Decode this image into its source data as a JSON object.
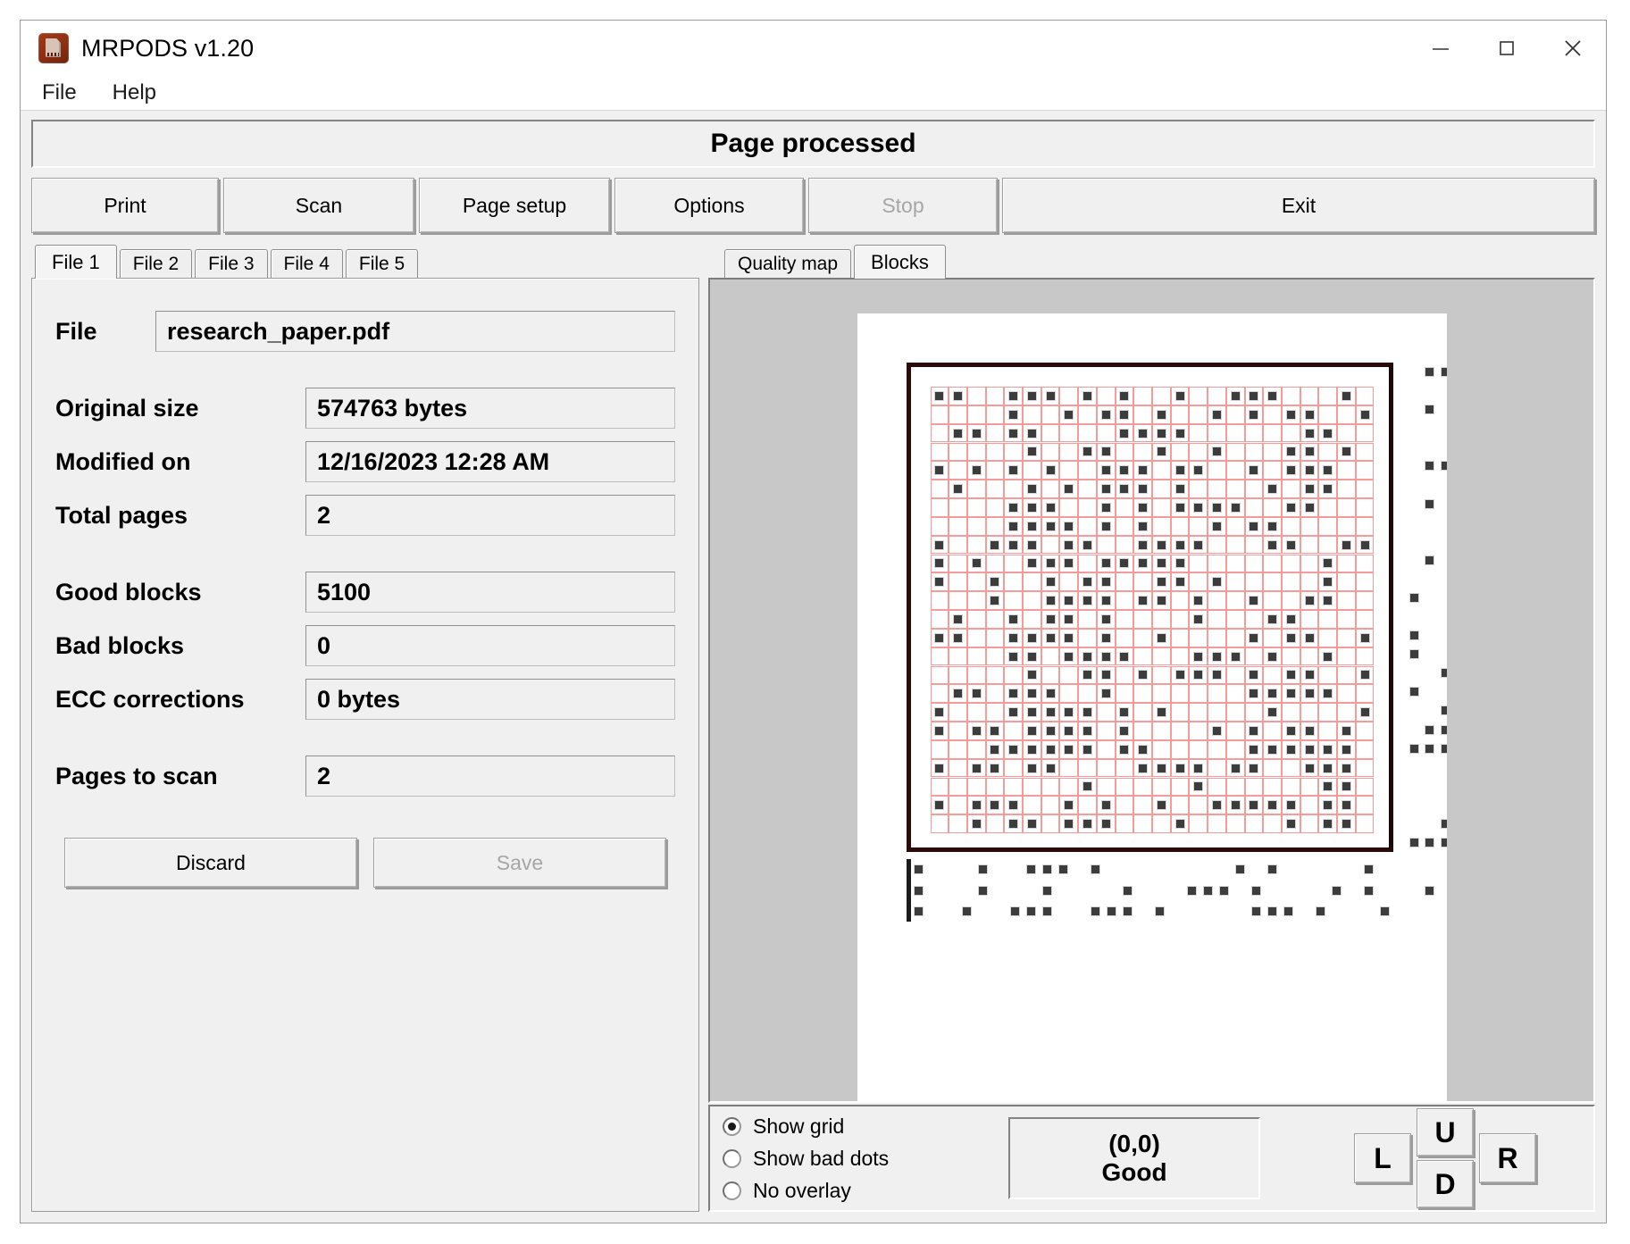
{
  "window": {
    "title": "MRPODS v1.20",
    "icon": "app-document-icon",
    "controls": {
      "minimize": "minimize-icon",
      "maximize": "maximize-icon",
      "close": "close-icon"
    }
  },
  "menu": {
    "items": [
      {
        "label": "File"
      },
      {
        "label": "Help"
      }
    ]
  },
  "status": {
    "message": "Page processed"
  },
  "toolbar": {
    "buttons": [
      {
        "label": "Print",
        "disabled": false
      },
      {
        "label": "Scan",
        "disabled": false
      },
      {
        "label": "Page setup",
        "disabled": false
      },
      {
        "label": "Options",
        "disabled": false
      },
      {
        "label": "Stop",
        "disabled": true
      },
      {
        "label": "Exit",
        "disabled": false
      }
    ]
  },
  "left_panel": {
    "tabs": [
      {
        "label": "File 1",
        "active": true
      },
      {
        "label": "File 2",
        "active": false
      },
      {
        "label": "File 3",
        "active": false
      },
      {
        "label": "File 4",
        "active": false
      },
      {
        "label": "File 5",
        "active": false
      }
    ],
    "fields": {
      "file_label": "File",
      "file_value": "research_paper.pdf",
      "original_size_label": "Original size",
      "original_size_value": "574763 bytes",
      "modified_on_label": "Modified on",
      "modified_on_value": "12/16/2023 12:28 AM",
      "total_pages_label": "Total pages",
      "total_pages_value": "2",
      "good_blocks_label": "Good blocks",
      "good_blocks_value": "5100",
      "bad_blocks_label": "Bad blocks",
      "bad_blocks_value": "0",
      "ecc_corrections_label": "ECC corrections",
      "ecc_corrections_value": "0 bytes",
      "pages_to_scan_label": "Pages to scan",
      "pages_to_scan_value": "2"
    },
    "buttons": {
      "discard_label": "Discard",
      "save_label": "Save",
      "save_disabled": true
    }
  },
  "right_panel": {
    "tabs": [
      {
        "label": "Quality map",
        "active": false
      },
      {
        "label": "Blocks",
        "active": true
      }
    ],
    "overlay_options": [
      {
        "label": "Show grid",
        "selected": true
      },
      {
        "label": "Show bad dots",
        "selected": false
      },
      {
        "label": "No overlay",
        "selected": false
      }
    ],
    "block_status": {
      "coordinates": "(0,0)",
      "quality": "Good"
    },
    "nav_buttons": [
      {
        "label": "L",
        "name": "nav-left-button"
      },
      {
        "label": "U",
        "name": "nav-up-button"
      },
      {
        "label": "D",
        "name": "nav-down-button"
      },
      {
        "label": "R",
        "name": "nav-right-button"
      }
    ]
  },
  "colors": {
    "grid_overlay": "#f79a9a",
    "dot": "#3c3c3c",
    "frame": "#2b0a0a",
    "window_face": "#f0f0f0",
    "preview_background": "#c8c8c8"
  }
}
